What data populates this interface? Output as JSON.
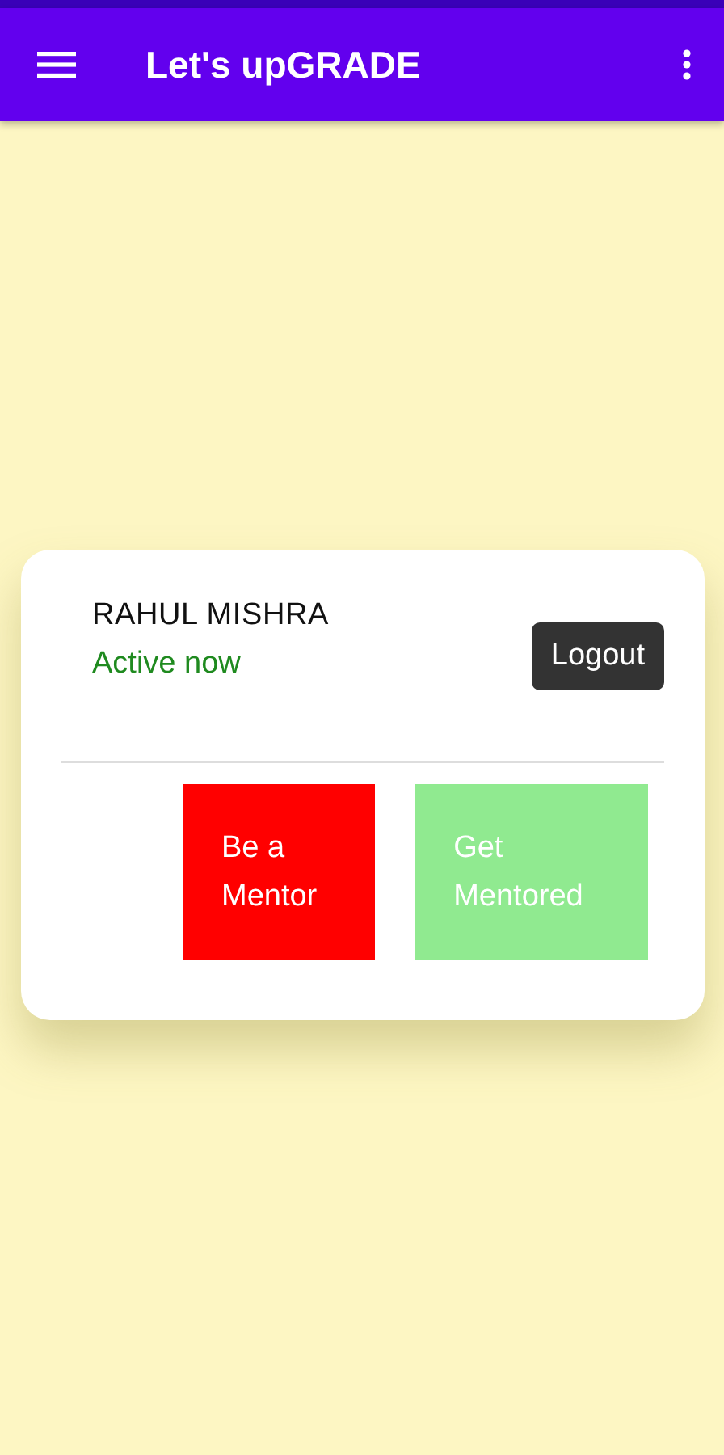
{
  "app_bar": {
    "title": "Let's upGRADE"
  },
  "profile": {
    "name": "RAHUL MISHRA",
    "status": "Active now",
    "logout": "Logout"
  },
  "actions": [
    {
      "label": "Be a Mentor",
      "color": "#ff0000"
    },
    {
      "label": "Get Mentored",
      "color": "#90ea90"
    }
  ]
}
